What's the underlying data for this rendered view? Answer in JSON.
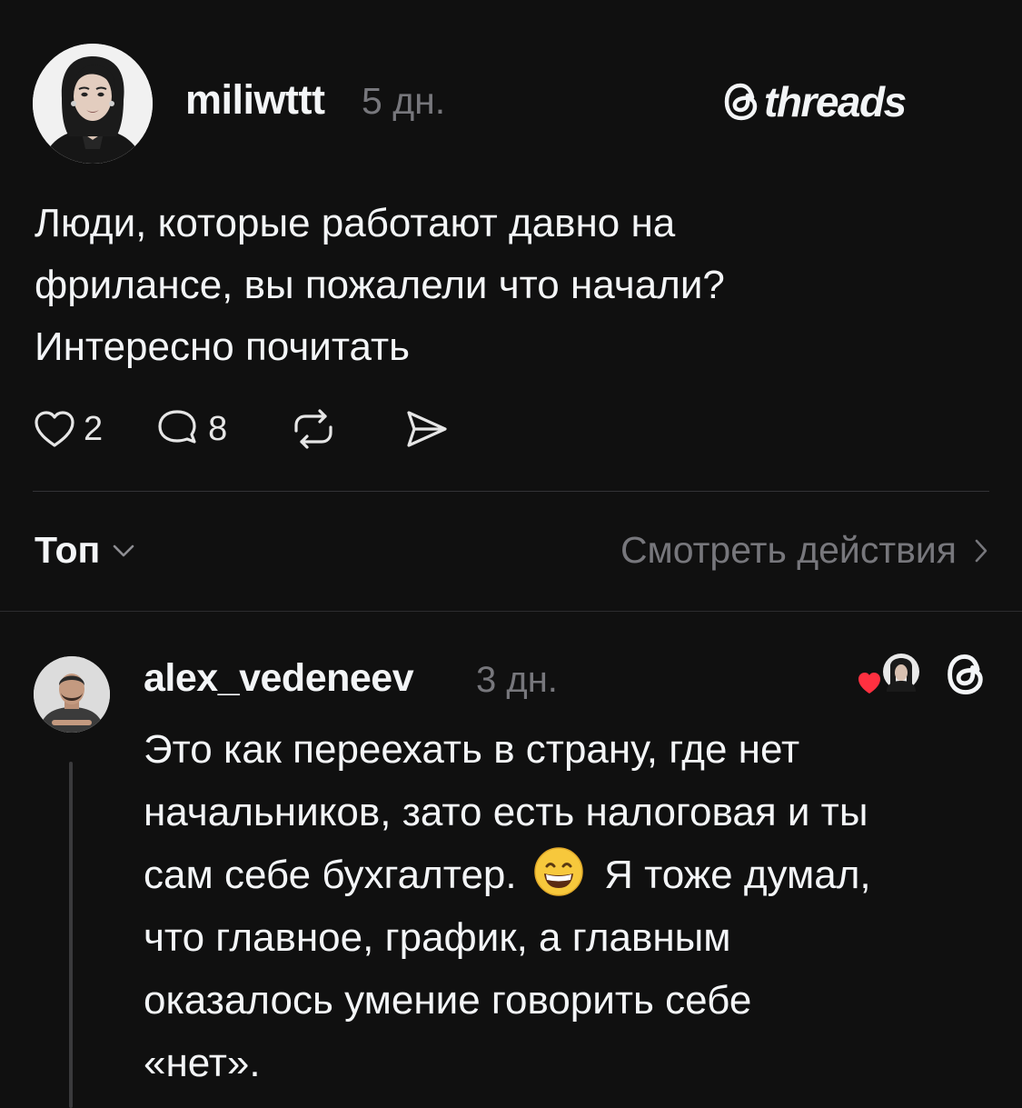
{
  "post": {
    "username": "miliwttt",
    "time": "5 дн.",
    "brand": "threads",
    "text_lines": [
      "Люди, которые работают давно на",
      "фрилансе, вы пожалели что начали?",
      "Интересно почитать"
    ],
    "likes": "2",
    "comments": "8"
  },
  "sort": {
    "label": "Топ",
    "activity_label": "Смотреть действия"
  },
  "reply": {
    "username": "alex_vedeneev",
    "time": "3 дн.",
    "line1": "Это как переехать в страну, где нет",
    "line2": "начальников, зато есть налоговая и ты",
    "line3_before_emoji": "сам себе бухгалтер.",
    "line3_after_emoji": "Я тоже думал,",
    "line4": "что главное, график, а главным",
    "line5": "оказалось умение говорить себе",
    "line6": "«нет».",
    "emoji": "grinning-face-with-smiling-eyes"
  },
  "colors": {
    "background": "#101010",
    "text_primary": "#f3f5f7",
    "text_secondary": "#77777c",
    "like_heart": "#ff3040",
    "divider": "#333336"
  },
  "icons": {
    "like": "heart-outline-icon",
    "comment": "speech-bubble-icon",
    "repost": "repost-arrows-icon",
    "share": "paper-plane-icon",
    "sort": "chevron-down-icon",
    "activity": "chevron-right-icon",
    "brand": "threads-logo-icon"
  }
}
